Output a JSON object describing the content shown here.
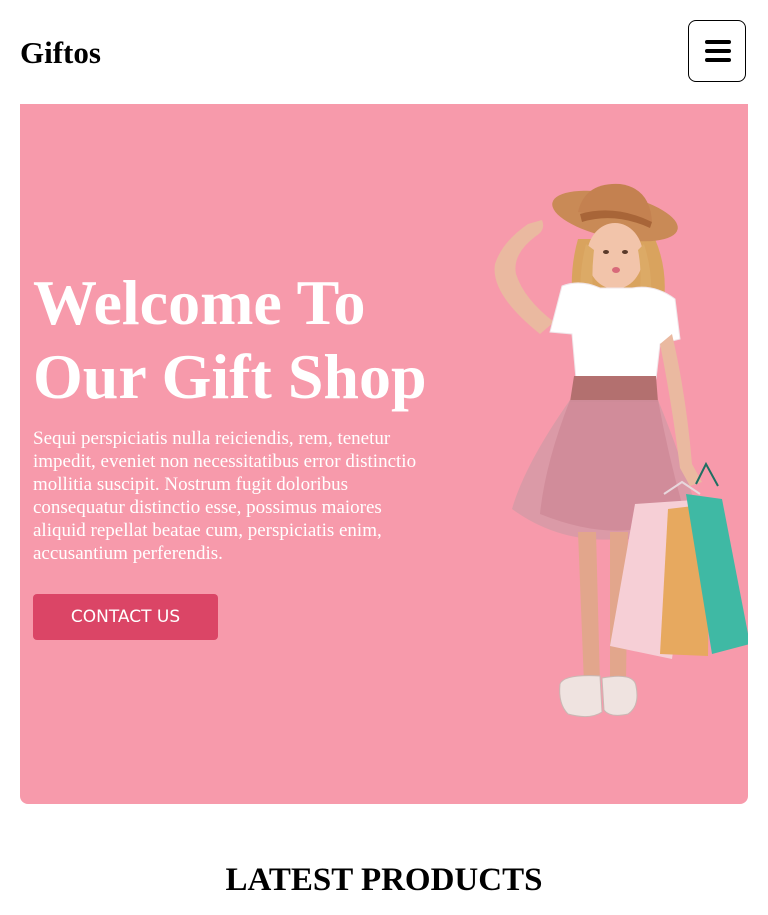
{
  "header": {
    "brand": "Giftos",
    "menu_icon": "hamburger-menu-icon"
  },
  "hero": {
    "title": "Welcome To Our Gift Shop",
    "description": "Sequi perspiciatis nulla reiciendis, rem, tenetur impedit, eveniet non necessitatibus error distinctio mollitia suscipit. Nostrum fugit doloribus consequatur distinctio esse, possimus maiores aliquid repellat beatae cum, perspiciatis enim, accusantium perferendis.",
    "cta_label": "CONTACT US",
    "image": "girl-with-shopping-bags-image"
  },
  "colors": {
    "hero_background": "#f79aab",
    "cta_background": "#db4566",
    "hero_text": "#ffffff"
  },
  "latest_products": {
    "heading": "LATEST PRODUCTS"
  }
}
